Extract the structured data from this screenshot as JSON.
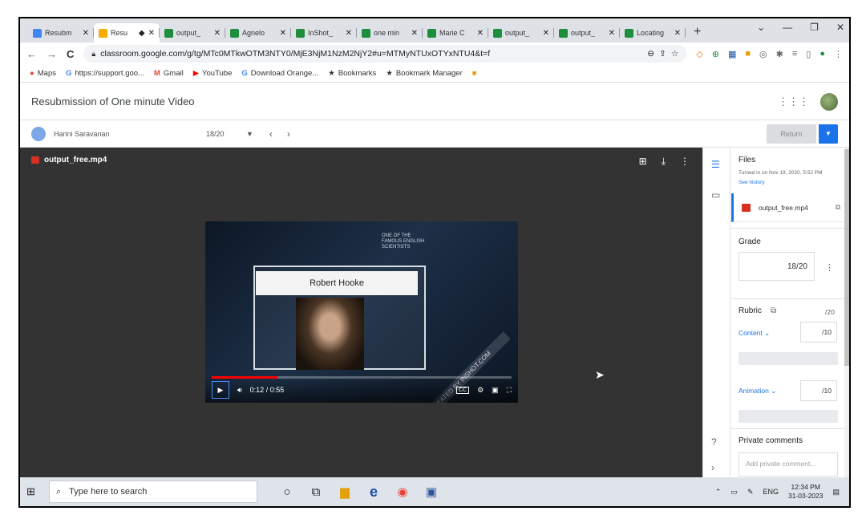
{
  "browser": {
    "tabs": [
      {
        "label": "Resubm",
        "color": "#4285f4",
        "active": false
      },
      {
        "label": "Resu",
        "color": "#f9ab00",
        "active": true
      },
      {
        "label": "output_",
        "color": "#1e8e3e",
        "active": false
      },
      {
        "label": "Agnelo",
        "color": "#1e8e3e",
        "active": false
      },
      {
        "label": "InShot_",
        "color": "#1e8e3e",
        "active": false
      },
      {
        "label": "one min",
        "color": "#1e8e3e",
        "active": false
      },
      {
        "label": "Marie C",
        "color": "#1e8e3e",
        "active": false
      },
      {
        "label": "output_",
        "color": "#1e8e3e",
        "active": false
      },
      {
        "label": "output_",
        "color": "#1e8e3e",
        "active": false
      },
      {
        "label": "Locating",
        "color": "#1e8e3e",
        "active": false
      }
    ],
    "url": "classroom.google.com/g/tg/MTc0MTkwOTM3NTY0/MjE3NjM1NzM2NjY2#u=MTMyNTUxOTYxNTU4&t=f",
    "bookmarks": [
      {
        "label": "Maps",
        "icon": "maps-pin-icon",
        "color": "#ea4335"
      },
      {
        "label": "https://support.goo...",
        "icon": "google-g-icon",
        "color": "#4285f4"
      },
      {
        "label": "Gmail",
        "icon": "gmail-icon",
        "color": "#ea4335"
      },
      {
        "label": "YouTube",
        "icon": "youtube-icon",
        "color": "#ff0000"
      },
      {
        "label": "Download Orange...",
        "icon": "google-g-icon",
        "color": "#4285f4"
      },
      {
        "label": "Bookmarks",
        "icon": "star-icon",
        "color": "#202124"
      },
      {
        "label": "Bookmark Manager",
        "icon": "star-icon",
        "color": "#202124"
      }
    ]
  },
  "classroom": {
    "title": "Resubmission of One minute Video",
    "student_name": "Harini Saravanan",
    "student_grade": "18/20",
    "return_label": "Return"
  },
  "viewer": {
    "file_name": "output_free.mp4",
    "video_title": "Robert Hooke",
    "tag_text": "ONE OF THE FAMOUS ENGLISH SCIENTISTS",
    "watermark": "CREATED BY INSHOT.COM",
    "time": "0:12 / 0:55",
    "progress": 0.22,
    "cc_label": "CC"
  },
  "panel": {
    "files_heading": "Files",
    "turned_in": "Turned in on Nov 19, 2020, 5:52 PM",
    "see_history": "See history",
    "file_name": "output_free.mp4",
    "grade_heading": "Grade",
    "grade_value": "18/20",
    "rubric_heading": "Rubric",
    "rubric_total": "/20",
    "criteria": [
      {
        "name": "Content",
        "points": "/10"
      },
      {
        "name": "Animation",
        "points": "/10"
      }
    ],
    "private_comments_heading": "Private comments",
    "comment_placeholder": "Add private comment..."
  },
  "taskbar": {
    "search_placeholder": "Type here to search",
    "language": "ENG",
    "time": "12:34 PM",
    "date": "31-03-2023"
  }
}
